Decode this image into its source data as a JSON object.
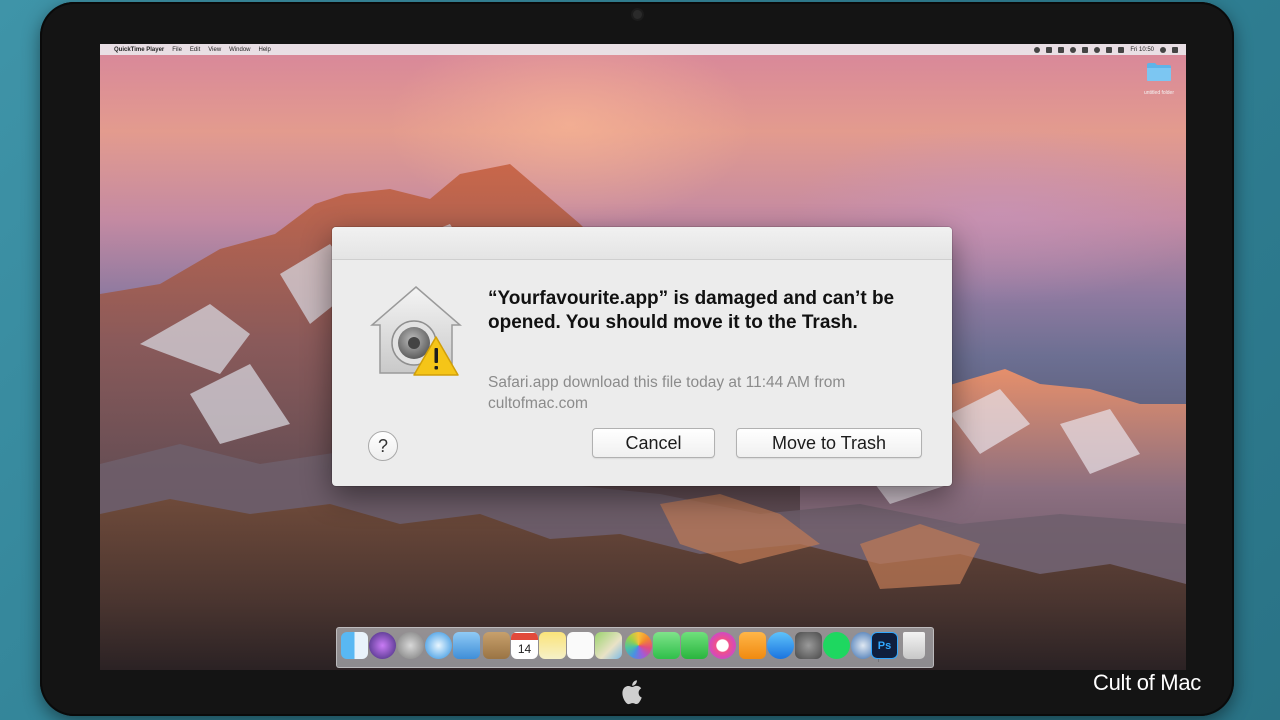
{
  "menubar": {
    "app_name": "QuickTime Player",
    "menus": [
      "File",
      "Edit",
      "View",
      "Window",
      "Help"
    ],
    "clock": "Fri 10:50"
  },
  "desktop": {
    "folder_label": "untitled folder"
  },
  "dialog": {
    "message": "“Yourfavourite.app” is damaged and can’t be opened. You should move it to the Trash.",
    "info": "Safari.app download this file today at 11:44 AM from cultofmac.com",
    "help_label": "?",
    "cancel_label": "Cancel",
    "trash_label": "Move to Trash"
  },
  "dock": {
    "calendar_day": "14",
    "photoshop_label": "Ps",
    "apps": [
      "finder-icon",
      "siri-icon",
      "launchpad-icon",
      "safari-icon",
      "mail-icon",
      "contacts-icon",
      "calendar-icon",
      "notes-icon",
      "reminders-icon",
      "maps-icon",
      "photos-icon",
      "messages-icon",
      "facetime-icon",
      "itunes-icon",
      "ibooks-icon",
      "app-store-icon",
      "system-preferences-icon",
      "spotify-icon",
      "quicktime-icon",
      "photoshop-icon",
      "trash-icon"
    ]
  },
  "watermark": "Cult of Mac",
  "colors": {
    "dialog_bg": "#ececec",
    "warning_yellow": "#f5c518",
    "background_teal": "#3f94a8"
  }
}
